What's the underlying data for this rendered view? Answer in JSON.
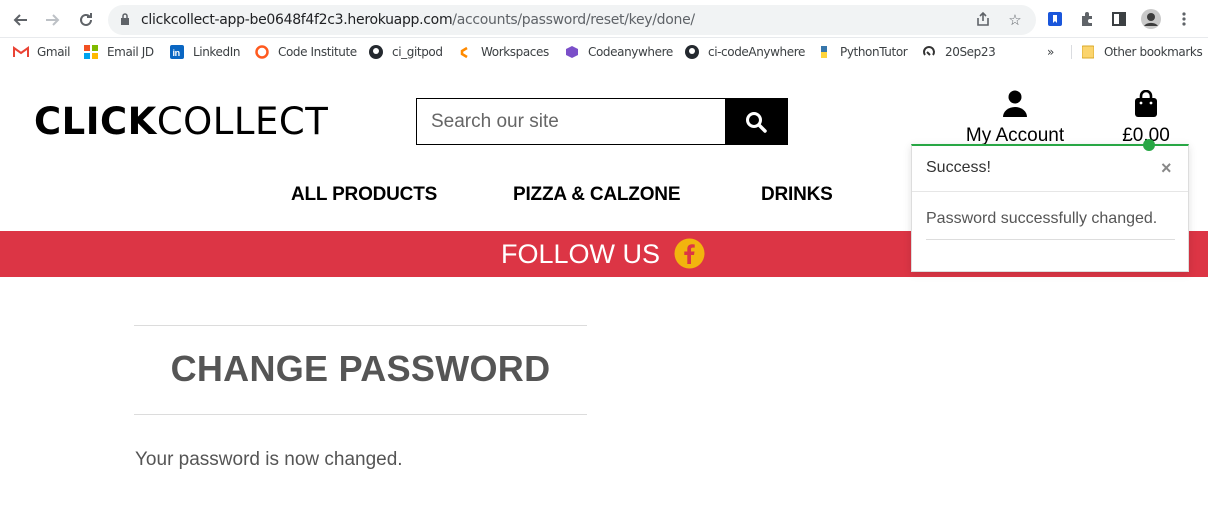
{
  "browser": {
    "url_host": "clickcollect-app-be0648f4f2c3.herokuapp.com",
    "url_path": "/accounts/password/reset/key/done/",
    "bookmarks": [
      "Gmail",
      "Email JD",
      "LinkedIn",
      "Code Institute",
      "ci_gitpod",
      "Workspaces",
      "Codeanywhere",
      "ci-codeAnywhere",
      "PythonTutor",
      "20Sep23"
    ],
    "overflow_label": "»",
    "other_bookmarks": "Other bookmarks"
  },
  "site": {
    "logo_bold": "CLICK",
    "logo_light": "COLLECT",
    "search_placeholder": "Search our site",
    "account_label": "My Account",
    "bag_total": "£0.00",
    "nav": [
      "ALL PRODUCTS",
      "PIZZA & CALZONE",
      "DRINKS"
    ],
    "banner_text": "FOLLOW US",
    "colors": {
      "banner": "#dc3545",
      "toast_accent": "#28a745",
      "facebook_badge": "#f2b40e"
    }
  },
  "page": {
    "title": "CHANGE PASSWORD",
    "message": "Your password is now changed."
  },
  "toast": {
    "title": "Success!",
    "close": "×",
    "message": "Password successfully changed."
  }
}
